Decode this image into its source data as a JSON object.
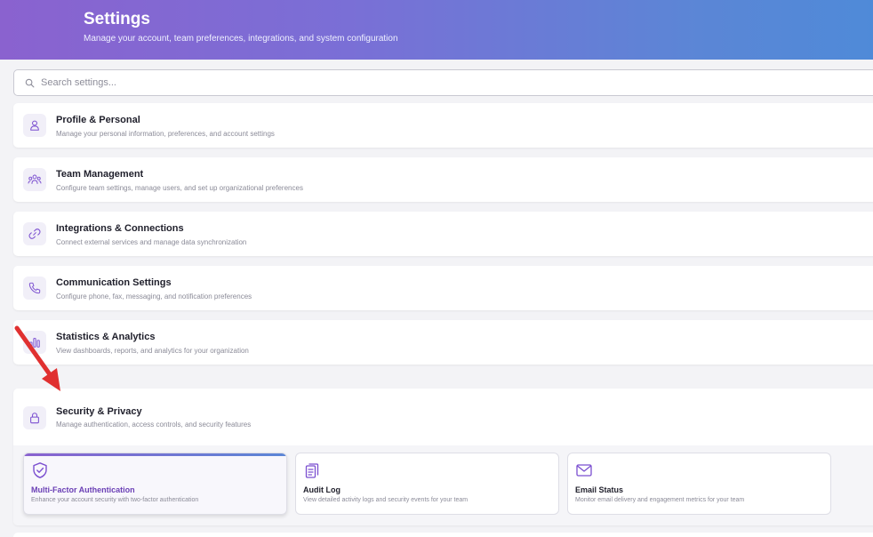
{
  "header": {
    "title": "Settings",
    "subtitle": "Manage your account, team preferences, integrations, and system configuration"
  },
  "search": {
    "placeholder": "Search settings...",
    "value": "",
    "icon": "search-icon"
  },
  "sections": [
    {
      "title": "Profile & Personal",
      "description": "Manage your personal information, preferences, and account settings",
      "icon": "user-icon"
    },
    {
      "title": "Team Management",
      "description": "Configure team settings, manage users, and set up organizational preferences",
      "icon": "team-icon"
    },
    {
      "title": "Integrations & Connections",
      "description": "Connect external services and manage data synchronization",
      "icon": "link-icon"
    },
    {
      "title": "Communication Settings",
      "description": "Configure phone, fax, messaging, and notification preferences",
      "icon": "phone-icon"
    },
    {
      "title": "Statistics & Analytics",
      "description": "View dashboards, reports, and analytics for your organization",
      "icon": "bar-chart-icon"
    },
    {
      "title": "Security & Privacy",
      "description": "Manage authentication, access controls, and security features",
      "icon": "lock-icon",
      "expanded": true
    }
  ],
  "security_items": [
    {
      "title": "Multi-Factor Authentication",
      "description": "Enhance your account security with two-factor authentication",
      "icon": "shield-check-icon",
      "active": true
    },
    {
      "title": "Audit Log",
      "description": "View detailed activity logs and security events for your team",
      "icon": "clipboard-icon"
    },
    {
      "title": "Email Status",
      "description": "Monitor email delivery and engagement metrics for your team",
      "icon": "mail-icon"
    }
  ],
  "colors": {
    "accent": "#7b4fd0",
    "header_start": "#8a62cf",
    "header_end": "#4f8ad8",
    "annotation_arrow": "#e03030"
  }
}
